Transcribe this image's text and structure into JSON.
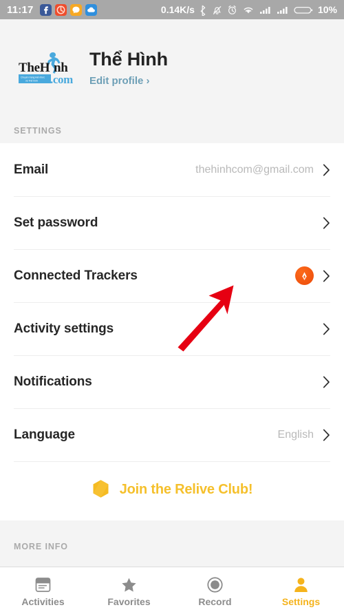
{
  "statusbar": {
    "time": "11:17",
    "network_speed": "0.14K/s",
    "battery_percent": "10%",
    "app_icons": [
      {
        "name": "facebook-icon",
        "color": "#3b5998"
      },
      {
        "name": "app-icon-orange-circle",
        "color": "#ee4d2d"
      },
      {
        "name": "app-icon-chat",
        "color": "#f7a823"
      },
      {
        "name": "app-icon-cloud",
        "color": "#2f8fdd"
      }
    ],
    "system_icons": [
      "bluetooth-icon",
      "mute-bell-icon",
      "alarm-clock-icon",
      "wifi-icon",
      "signal-bars-icon",
      "signal-bars-2-icon",
      "battery-icon"
    ]
  },
  "profile": {
    "avatar_name": "thehinh-com-logo",
    "avatar_text_main": "TheH",
    "avatar_text_tail": "nh",
    "avatar_text_domain": ".com",
    "avatar_tagline": "Chuyên trang kiến thức về Thể hình",
    "name": "Thể Hình",
    "edit_label": "Edit profile ›"
  },
  "settings_section": {
    "header": "SETTINGS",
    "rows": [
      {
        "label": "Email",
        "value": "thehinhcom@gmail.com",
        "icon": "",
        "chevron": true
      },
      {
        "label": "Set password",
        "value": "",
        "icon": "",
        "chevron": true
      },
      {
        "label": "Connected Trackers",
        "value": "",
        "icon": "strava-icon",
        "chevron": true
      },
      {
        "label": "Activity settings",
        "value": "",
        "icon": "",
        "chevron": true
      },
      {
        "label": "Notifications",
        "value": "",
        "icon": "",
        "chevron": true
      },
      {
        "label": "Language",
        "value": "English",
        "icon": "",
        "chevron": true
      }
    ]
  },
  "club": {
    "icon_name": "hexagon-badge-icon",
    "label": "Join the Relive Club!",
    "color": "#f5c02c"
  },
  "more_info": {
    "header": "MORE INFO"
  },
  "tabbar": {
    "items": [
      {
        "label": "Activities",
        "icon": "card-icon",
        "active": false
      },
      {
        "label": "Favorites",
        "icon": "star-icon",
        "active": false
      },
      {
        "label": "Record",
        "icon": "record-circle-icon",
        "active": false
      },
      {
        "label": "Settings",
        "icon": "person-icon",
        "active": true
      }
    ],
    "active_color": "#f5b31c",
    "inactive_color": "#8c8c8c"
  },
  "annotation": {
    "name": "red-arrow-pointing-to-connected-trackers",
    "color": "#e60012"
  }
}
